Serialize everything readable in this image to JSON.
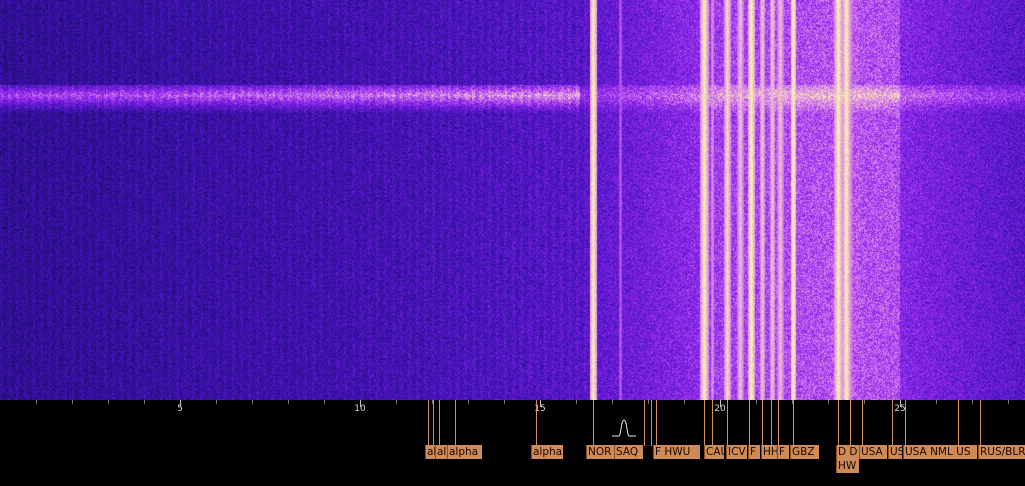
{
  "spectrum": {
    "x_ticks": [
      "5",
      "10",
      "15",
      "20",
      "25"
    ],
    "colors": {
      "background": "#000000",
      "label": "#cf8b57",
      "marker": "#d0905a"
    }
  },
  "stations": [
    {
      "id": "s1",
      "label": "alpha"
    },
    {
      "id": "s2",
      "label": "alpha"
    },
    {
      "id": "s3",
      "label": "alpha"
    },
    {
      "id": "s4",
      "label": "alpha"
    },
    {
      "id": "s5",
      "label": "NOR"
    },
    {
      "id": "s6",
      "label": "SAQ"
    },
    {
      "id": "s7",
      "label": "F HWU"
    },
    {
      "id": "s8",
      "label": "CAU"
    },
    {
      "id": "s9",
      "label": "ICV"
    },
    {
      "id": "s10",
      "label": "F"
    },
    {
      "id": "s11",
      "label": "HHF"
    },
    {
      "id": "s12",
      "label": "F"
    },
    {
      "id": "s13",
      "label": "GBZ"
    },
    {
      "id": "s14",
      "label": "D D"
    },
    {
      "id": "s15",
      "label": "HW"
    },
    {
      "id": "s16",
      "label": "USA"
    },
    {
      "id": "s17",
      "label": "US"
    },
    {
      "id": "s18",
      "label": "USA NML US"
    },
    {
      "id": "s19",
      "label": "RUS/BLR"
    }
  ],
  "filter_icon": "passband-filter-icon"
}
